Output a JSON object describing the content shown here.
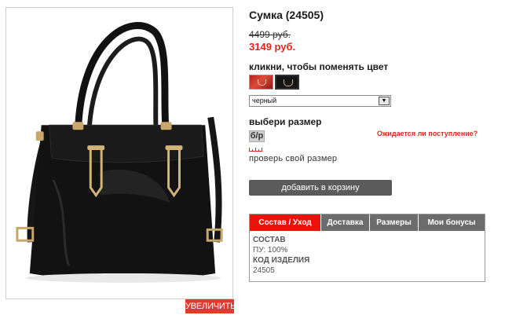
{
  "product": {
    "title": "Сумка (24505)",
    "old_price": "4499 руб.",
    "new_price": "3149 руб.",
    "image_icon": "handbag-image",
    "zoom_label": "УВЕЛИЧИТЬ"
  },
  "color": {
    "label": "кликни, чтобы поменять цвет",
    "swatches": [
      {
        "name": "red",
        "color": "#c22a20"
      },
      {
        "name": "black",
        "color": "#151515"
      }
    ],
    "selected": "черный"
  },
  "size": {
    "label": "выбери размер",
    "selected": "б/р",
    "expected_link": "Ожидается ли поступление?",
    "check_label": "проверь свой размер"
  },
  "cart": {
    "add_label": "добавить в корзину"
  },
  "tabs": {
    "items": [
      {
        "label": "Состав / Уход",
        "active": true
      },
      {
        "label": "Доставка",
        "active": false
      },
      {
        "label": "Размеры",
        "active": false
      },
      {
        "label": "Мои бонусы",
        "active": false
      }
    ],
    "content": {
      "composition_heading": "СОСТАВ",
      "composition_value": "ПУ: 100%",
      "code_heading": "КОД ИЗДЕЛИЯ",
      "code_value": "24505"
    }
  },
  "colors": {
    "accent_red": "#e8140c",
    "price_red": "#e0251f",
    "button_gray": "#5b5b5b",
    "tab_gray": "#6c6c6c"
  }
}
